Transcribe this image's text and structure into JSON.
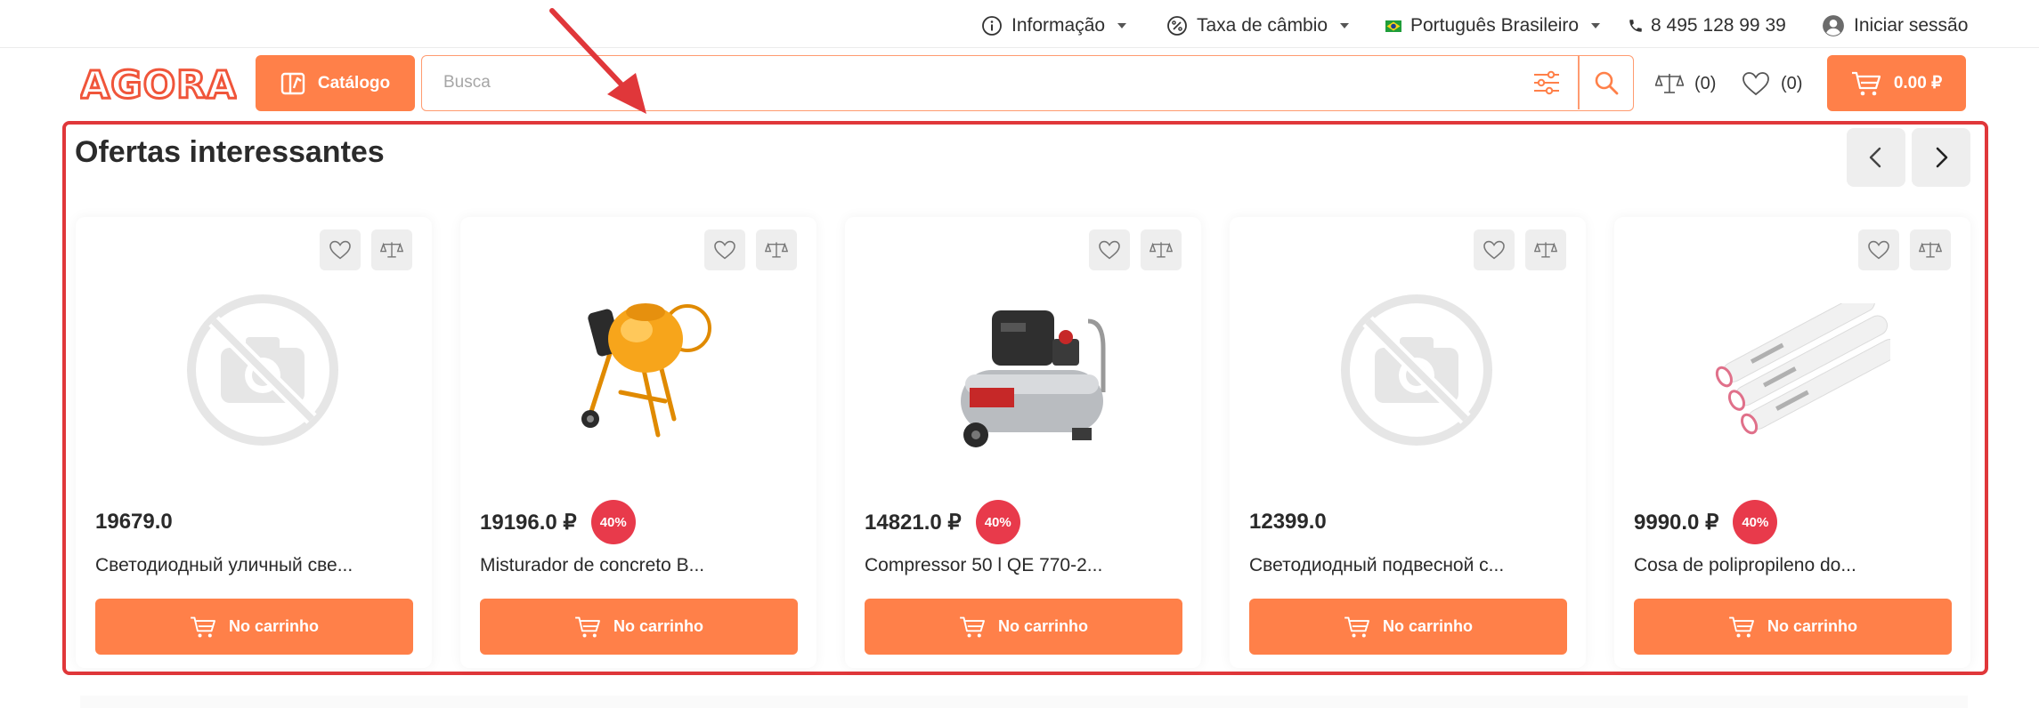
{
  "topbar": {
    "info_label": "Informação",
    "currency_label": "Taxa de câmbio",
    "language_label": "Português Brasileiro",
    "phone": "8 495 128 99 39",
    "login_label": "Iniciar sessão"
  },
  "header": {
    "logo_text": "AGORA",
    "catalog_label": "Catálogo",
    "search_placeholder": "Busca",
    "compare_count": "(0)",
    "favorites_count": "(0)",
    "cart_total": "0.00 ₽"
  },
  "colors": {
    "accent": "#ff8049",
    "discount": "#e83a4b",
    "annotation": "#e0373a"
  },
  "section": {
    "title": "Ofertas interessantes"
  },
  "products": [
    {
      "price": "19679.0",
      "discount": "",
      "name": "Светодиодный уличный све...",
      "cart_label": "No carrinho",
      "image": "no-photo"
    },
    {
      "price": "19196.0 ₽",
      "discount": "40%",
      "name": "Misturador de concreto B...",
      "cart_label": "No carrinho",
      "image": "concrete-mixer"
    },
    {
      "price": "14821.0 ₽",
      "discount": "40%",
      "name": "Compressor 50 l QE 770-2...",
      "cart_label": "No carrinho",
      "image": "air-compressor"
    },
    {
      "price": "12399.0",
      "discount": "",
      "name": "Светодиодный подвесной с...",
      "cart_label": "No carrinho",
      "image": "no-photo"
    },
    {
      "price": "9990.0 ₽",
      "discount": "40%",
      "name": "Cosa de polipropileno do...",
      "cart_label": "No carrinho",
      "image": "pipes"
    }
  ]
}
